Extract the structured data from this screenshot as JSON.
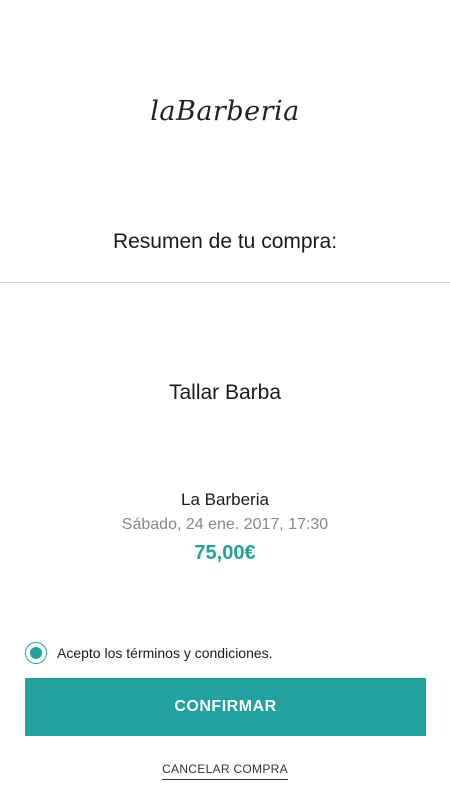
{
  "brand": {
    "logo_text": "laBarberia"
  },
  "summary": {
    "title": "Resumen de tu compra:"
  },
  "order": {
    "service_name": "Tallar Barba",
    "venue": "La Barberia",
    "datetime": "Sábado, 24 ene. 2017, 17:30",
    "price": "75,00€"
  },
  "terms": {
    "label": "Acepto los términos y condiciones.",
    "checked": true
  },
  "actions": {
    "confirm_label": "CONFIRMAR",
    "cancel_label": "CANCELAR COMPRA"
  },
  "colors": {
    "accent": "#21a29f",
    "text": "#1a1a1a",
    "muted": "#888888",
    "divider": "#d9d9d9"
  }
}
